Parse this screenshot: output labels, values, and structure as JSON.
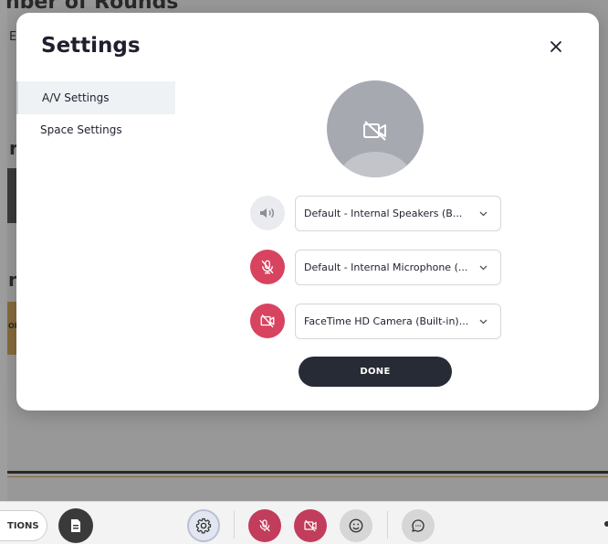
{
  "background": {
    "title_fragment": "nber of Rounds",
    "letters": [
      "E",
      "r",
      "n",
      "OR"
    ]
  },
  "modal": {
    "title": "Settings",
    "close_icon": "close-icon",
    "sidebar": {
      "items": [
        {
          "label": "A/V Settings",
          "active": true
        },
        {
          "label": "Space Settings",
          "active": false
        }
      ]
    },
    "avatar_icon": "camera-off-icon",
    "devices": {
      "speaker": {
        "icon": "speaker-icon",
        "value": "Default - Internal Speakers (B..."
      },
      "microphone": {
        "icon": "microphone-off-icon",
        "value": "Default - Internal Microphone (..."
      },
      "camera": {
        "icon": "camera-off-icon",
        "value": "FaceTime HD Camera (Built-in)..."
      }
    },
    "done_label": "DONE"
  },
  "toolbar": {
    "options_label": "TIONS",
    "buttons": [
      "document-icon",
      "gear-icon",
      "microphone-off-icon",
      "camera-off-icon",
      "emoji-icon",
      "chat-icon"
    ]
  },
  "colors": {
    "accent_red": "#d8435f",
    "done_button": "#272b35",
    "overlay": "#282828"
  }
}
